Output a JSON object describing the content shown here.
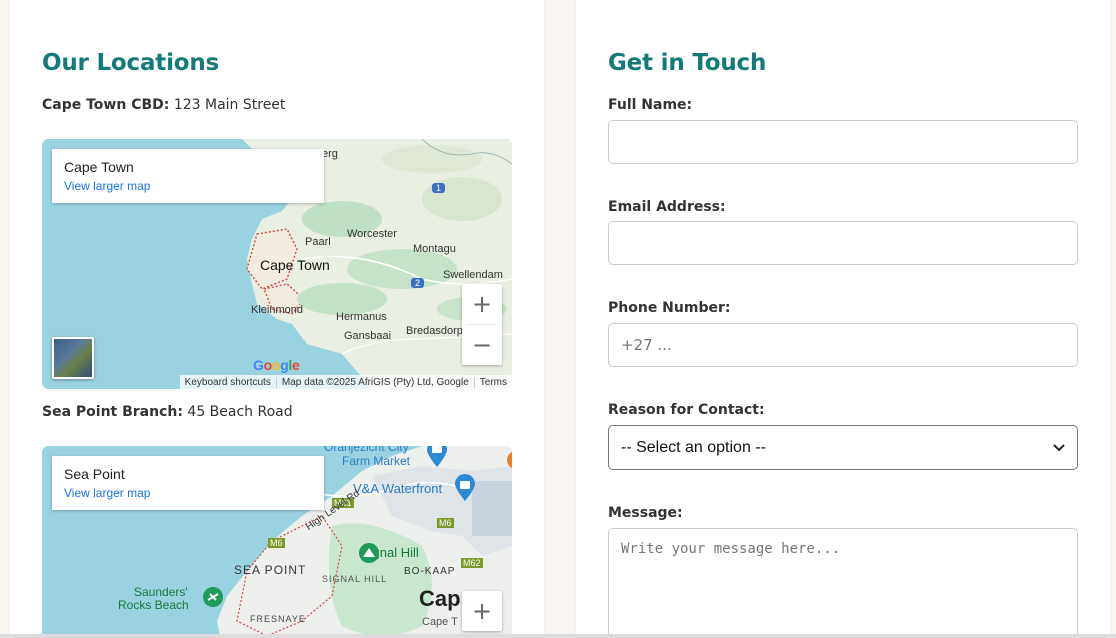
{
  "locations": {
    "title": "Our Locations",
    "branches": [
      {
        "name": "Cape Town CBD:",
        "address": "123 Main Street",
        "map": {
          "place": "Cape Town",
          "larger_map_link": "View larger map",
          "labels": {
            "city": "Cape Town",
            "paarl": "Paarl",
            "worcester": "Worcester",
            "montagu": "Montagu",
            "swellendam": "Swellendam",
            "kleinmond": "Kleinmond",
            "hermanus": "Hermanus",
            "bredasdorp": "Bredasdorp",
            "gansbaai": "Gansbaai",
            "erg": "erg",
            "route1": "1",
            "route2": "2"
          },
          "google": "Google",
          "attribution": [
            "Keyboard shortcuts",
            "Map data ©2025 AfriGIS (Pty) Ltd, Google",
            "Terms"
          ]
        }
      },
      {
        "name": "Sea Point Branch:",
        "address": "45 Beach Road",
        "map": {
          "place": "Sea Point",
          "larger_map_link": "View larger map",
          "labels": {
            "oranjezicht": "Oranjezicht City",
            "farm_market": "Farm Market",
            "va_waterfront": "V&A Waterfront",
            "high_level": "High Level Rd",
            "signal_hill": "Signal Hill",
            "sea_point": "SEA POINT",
            "signal_hill_area": "SIGNAL HILL",
            "bo_kaap": "BO-KAAP",
            "saunders1": "Saunders'",
            "saunders2": "Rocks Beach",
            "fresnaye": "FRESNAYE",
            "cape": "Cap",
            "cape2": "Cape T",
            "m61": "M61",
            "m6a": "M6",
            "m6b": "M6",
            "m62": "M62"
          }
        }
      }
    ]
  },
  "contact": {
    "title": "Get in Touch",
    "full_name_label": "Full Name:",
    "email_label": "Email Address:",
    "phone_label": "Phone Number:",
    "phone_placeholder": "+27 ...",
    "reason_label": "Reason for Contact:",
    "reason_selected": "-- Select an option --",
    "message_label": "Message:",
    "message_placeholder": "Write your message here..."
  },
  "colors": {
    "accent": "#137a78",
    "link": "#1a73e8",
    "water": "#9ad3e0"
  }
}
